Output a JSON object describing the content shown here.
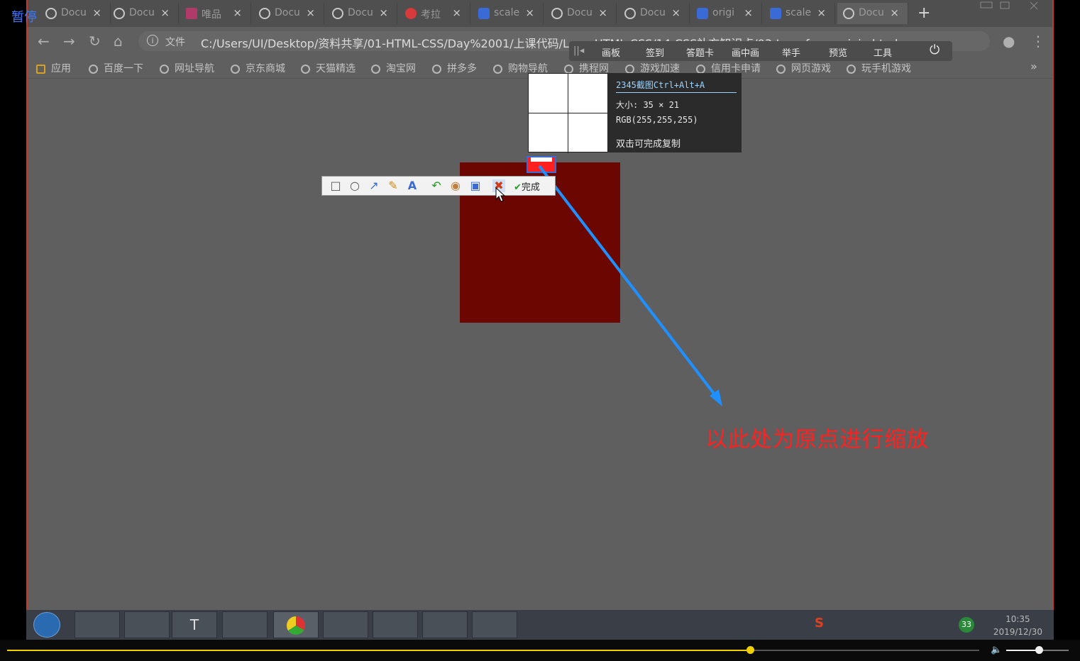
{
  "player": {
    "status": "暂停"
  },
  "tabs": [
    {
      "title": "Docu",
      "icon": "globe-icon"
    },
    {
      "title": "Docu",
      "icon": "globe-icon"
    },
    {
      "title": "唯品",
      "icon": "vip-icon"
    },
    {
      "title": "Docu",
      "icon": "globe-icon"
    },
    {
      "title": "Docu",
      "icon": "globe-icon"
    },
    {
      "title": "考拉",
      "icon": "kaola-icon"
    },
    {
      "title": "scale",
      "icon": "baidu-paw-icon"
    },
    {
      "title": "Docu",
      "icon": "globe-icon"
    },
    {
      "title": "Docu",
      "icon": "globe-icon"
    },
    {
      "title": "origi",
      "icon": "baidu-paw-icon"
    },
    {
      "title": "scale",
      "icon": "bird-icon"
    },
    {
      "title": "Docu",
      "icon": "globe-icon"
    }
  ],
  "address": {
    "label": "文件",
    "url": "C:/Users/UI/Desktop/资料共享/01-HTML-CSS/Day%2001/上课代码/LearnHTML-CSS/14-CSS补充知识点/03-transform-origin.html"
  },
  "bookmarks": [
    "应用",
    "百度一下",
    "网址导航",
    "京东商城",
    "天猫精选",
    "淘宝网",
    "拼多多",
    "购物导航",
    "携程网",
    "游戏加速",
    "信用卡申请",
    "网页游戏",
    "玩手机游戏"
  ],
  "classbar": [
    "画板",
    "签到",
    "答题卡",
    "画中画",
    "举手",
    "预览",
    "工具"
  ],
  "capture": {
    "title": "2345截图Ctrl+Alt+A",
    "size": "大小: 35 × 21",
    "rgb": "RGB(255,255,255)",
    "hint": "双击可完成复制",
    "done_label": "完成"
  },
  "annotation": "以此处为原点进行缩放",
  "colors": {
    "box": "#6b0700",
    "annotation": "#ff2020",
    "arrow": "#1e90ff"
  },
  "clock": {
    "time": "10:35",
    "date": "2019/12/30"
  },
  "tray": {
    "badge": "33"
  },
  "video": {
    "progress": 0.764,
    "volume": 0.52
  }
}
